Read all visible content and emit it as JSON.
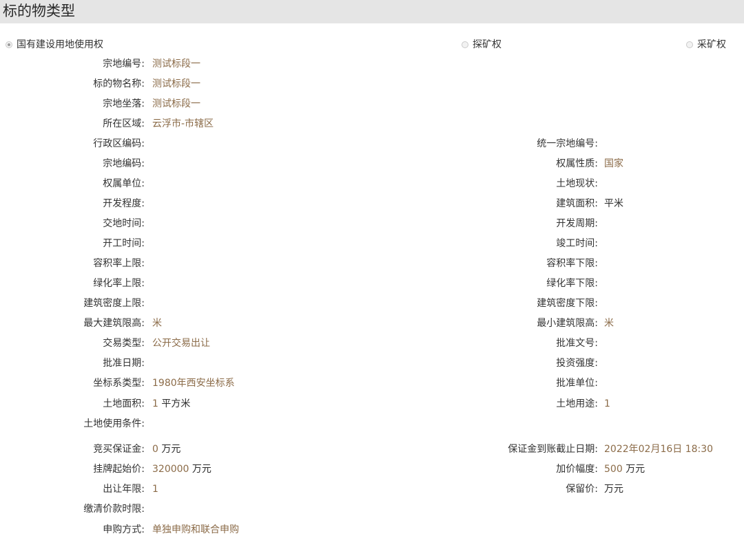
{
  "header": {
    "title": "标的物类型"
  },
  "radios": [
    {
      "label": "国有建设用地使用权",
      "checked": true
    },
    {
      "label": "探矿权",
      "checked": false
    },
    {
      "label": "采矿权",
      "checked": false
    }
  ],
  "fields": {
    "zongdi_bianhao": {
      "label": "宗地编号:",
      "value": "测试标段一"
    },
    "biaodiwu_mingcheng": {
      "label": "标的物名称:",
      "value": "测试标段一"
    },
    "zongdi_zuoluo": {
      "label": "宗地坐落:",
      "value": "测试标段一"
    },
    "suozai_quyu": {
      "label": "所在区域:",
      "value": "云浮市-市辖区"
    },
    "xingzhengqu_bianma": {
      "label": "行政区编码:",
      "value": ""
    },
    "tongyi_zongdi_bianhao": {
      "label": "统一宗地编号:",
      "value": ""
    },
    "zongdi_bianma": {
      "label": "宗地编码:",
      "value": ""
    },
    "quanshu_xingzhi": {
      "label": "权属性质:",
      "value": "国家"
    },
    "quanshu_danwei": {
      "label": "权属单位:",
      "value": ""
    },
    "tudi_xianzhuang": {
      "label": "土地现状:",
      "value": ""
    },
    "kaifa_chengdu": {
      "label": "开发程度:",
      "value": ""
    },
    "jianzhu_mianji": {
      "label": "建筑面积:",
      "value": "",
      "unit": "平米"
    },
    "jiaodi_shijian": {
      "label": "交地时间:",
      "value": ""
    },
    "kaifa_zhouqi": {
      "label": "开发周期:",
      "value": ""
    },
    "kaigong_shijian": {
      "label": "开工时间:",
      "value": ""
    },
    "jungong_shijian": {
      "label": "竣工时间:",
      "value": ""
    },
    "rongjilv_shangxian": {
      "label": "容积率上限:",
      "value": ""
    },
    "rongjilv_xiaxian": {
      "label": "容积率下限:",
      "value": ""
    },
    "lvhualv_shangxian": {
      "label": "绿化率上限:",
      "value": ""
    },
    "lvhualv_xiaxian": {
      "label": "绿化率下限:",
      "value": ""
    },
    "jianzhu_midu_shangxian": {
      "label": "建筑密度上限:",
      "value": ""
    },
    "jianzhu_midu_xiaxian": {
      "label": "建筑密度下限:",
      "value": ""
    },
    "zuida_jianzhu_xiangao": {
      "label": "最大建筑限高:",
      "value": "米"
    },
    "zuixiao_jianzhu_xiangao": {
      "label": "最小建筑限高:",
      "value": "米"
    },
    "jiaoyi_leixing": {
      "label": "交易类型:",
      "value": "公开交易出让"
    },
    "pizhun_wenhao": {
      "label": "批准文号:",
      "value": ""
    },
    "pizhun_riqi": {
      "label": "批准日期:",
      "value": ""
    },
    "touzi_qiangdu": {
      "label": "投资强度:",
      "value": ""
    },
    "zuobiaoxi_leixing": {
      "label": "坐标系类型:",
      "value": "1980年西安坐标系"
    },
    "pizhun_danwei": {
      "label": "批准单位:",
      "value": ""
    },
    "tudi_mianji": {
      "label": "土地面积:",
      "value": "1",
      "unit": "平方米"
    },
    "tudi_yongtu": {
      "label": "土地用途:",
      "value": "1"
    },
    "tudi_shiyong_tiaojian": {
      "label": "土地使用条件:",
      "value": ""
    },
    "jingmai_baozhengjin": {
      "label": "竞买保证金:",
      "value": "0",
      "unit": "万元"
    },
    "baozhengjin_jiezhi_riqi": {
      "label": "保证金到账截止日期:",
      "value": "2022年02月16日 18:30"
    },
    "guapai_qishijia": {
      "label": "挂牌起始价:",
      "value": "320000",
      "unit": "万元"
    },
    "jiajia_fudu": {
      "label": "加价幅度:",
      "value": "500",
      "unit": "万元"
    },
    "churang_nianxian": {
      "label": "出让年限:",
      "value": "1"
    },
    "baoliujia": {
      "label": "保留价:",
      "value": "",
      "unit": "万元"
    },
    "jiaoqing_jiakuan_shixian": {
      "label": "缴清价款时限:",
      "value": ""
    },
    "shengou_fangshi": {
      "label": "申购方式:",
      "value": "单独申购和联合申购"
    }
  }
}
